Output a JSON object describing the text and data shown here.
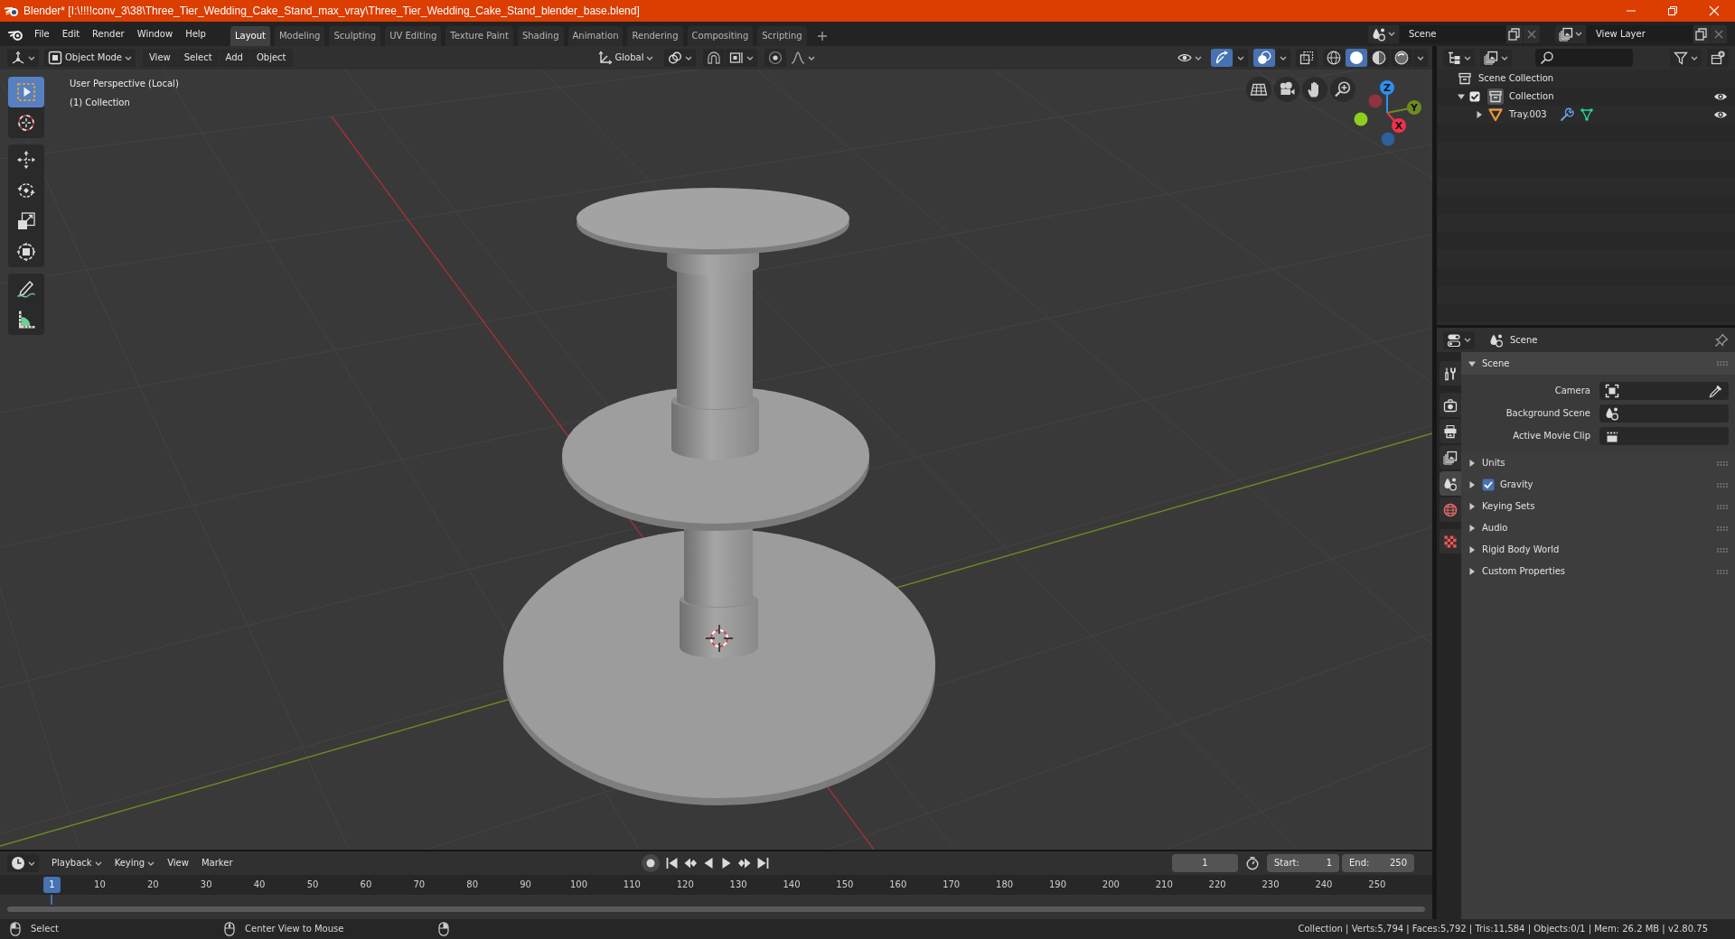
{
  "title_bar": {
    "title": "Blender* [I:\\!!!!conv_3\\38\\Three_Tier_Wedding_Cake_Stand_max_vray\\Three_Tier_Wedding_Cake_Stand_blender_base.blend]"
  },
  "top_bar": {
    "menus": [
      "File",
      "Edit",
      "Render",
      "Window",
      "Help"
    ],
    "workspaces": [
      {
        "label": "Layout",
        "selected": true
      },
      {
        "label": "Modeling",
        "selected": false
      },
      {
        "label": "Sculpting",
        "selected": false
      },
      {
        "label": "UV Editing",
        "selected": false
      },
      {
        "label": "Texture Paint",
        "selected": false
      },
      {
        "label": "Shading",
        "selected": false
      },
      {
        "label": "Animation",
        "selected": false
      },
      {
        "label": "Rendering",
        "selected": false
      },
      {
        "label": "Compositing",
        "selected": false
      },
      {
        "label": "Scripting",
        "selected": false
      }
    ],
    "scene": "Scene",
    "view_layer": "View Layer"
  },
  "viewport": {
    "mode": "Object Mode",
    "menus": [
      "View",
      "Select",
      "Add",
      "Object"
    ],
    "orientation": "Global",
    "toggles": [
      {
        "kind": "gizmos",
        "on": true
      },
      {
        "kind": "overlays",
        "on": true
      },
      {
        "kind": "xray",
        "on": false
      }
    ],
    "shading_modes": [
      {
        "kind": "wireframe",
        "selected": false
      },
      {
        "kind": "solid",
        "selected": true
      },
      {
        "kind": "material",
        "selected": false
      },
      {
        "kind": "rendered",
        "selected": false
      }
    ],
    "toolbar": [
      [
        {
          "kind": "select_box",
          "selected": true
        },
        {
          "kind": "cursor",
          "selected": false
        }
      ],
      [
        {
          "kind": "move",
          "selected": false
        },
        {
          "kind": "rotate",
          "selected": false
        },
        {
          "kind": "scale",
          "selected": false
        },
        {
          "kind": "transform",
          "selected": false
        }
      ],
      [
        {
          "kind": "annotate",
          "selected": false
        },
        {
          "kind": "measure",
          "selected": false
        }
      ]
    ],
    "info": [
      "User Perspective (Local)",
      "(1) Collection"
    ],
    "gizmo_axes": [
      "Z",
      "Y",
      "X"
    ]
  },
  "outliner": {
    "tree": [
      {
        "label": "Scene Collection",
        "kind": "scene_collection",
        "children": [
          {
            "label": "Collection",
            "kind": "collection",
            "expanded": true,
            "checked": true,
            "active": true,
            "visible": true,
            "children": [
              {
                "label": "Tray.003",
                "kind": "mesh",
                "expanded": false,
                "visible": true
              }
            ]
          }
        ]
      }
    ]
  },
  "properties": {
    "context": "Scene",
    "tabs": [
      [
        {
          "kind": "tool",
          "selected": false
        }
      ],
      [
        {
          "kind": "render",
          "selected": false
        },
        {
          "kind": "output",
          "selected": false
        },
        {
          "kind": "view_layer",
          "selected": false
        },
        {
          "kind": "scene",
          "selected": true
        },
        {
          "kind": "world",
          "selected": false
        }
      ],
      [
        {
          "kind": "texture",
          "selected": false
        }
      ]
    ],
    "panels": [
      {
        "title": "Scene",
        "expanded": true,
        "fields": [
          {
            "label": "Camera",
            "kind": "camera"
          },
          {
            "label": "Background Scene",
            "kind": "scene"
          },
          {
            "label": "Active Movie Clip",
            "kind": "clip"
          }
        ]
      },
      {
        "title": "Units",
        "expanded": false
      },
      {
        "title": "Gravity",
        "expanded": false,
        "checked": true
      },
      {
        "title": "Keying Sets",
        "expanded": false
      },
      {
        "title": "Audio",
        "expanded": false
      },
      {
        "title": "Rigid Body World",
        "expanded": false
      },
      {
        "title": "Custom Properties",
        "expanded": false
      }
    ]
  },
  "timeline": {
    "menus": [
      {
        "label": "Playback",
        "kind": "dropdown"
      },
      {
        "label": "Keying",
        "kind": "dropdown"
      },
      {
        "label": "View",
        "kind": "menu"
      },
      {
        "label": "Marker",
        "kind": "menu"
      }
    ],
    "current_frame": "1",
    "start_label": "Start:",
    "start": "1",
    "end_label": "End:",
    "end": "250",
    "playhead": "1",
    "ruler": [
      "10",
      "20",
      "30",
      "40",
      "50",
      "60",
      "70",
      "80",
      "90",
      "100",
      "110",
      "120",
      "130",
      "140",
      "150",
      "160",
      "170",
      "180",
      "190",
      "200",
      "210",
      "220",
      "230",
      "240",
      "250"
    ]
  },
  "status_bar": {
    "hints": [
      {
        "kind": "left_click",
        "label": "Select"
      },
      {
        "kind": "middle_click",
        "label": "Center View to Mouse"
      },
      {
        "kind": "right_click"
      }
    ],
    "stats": "Collection | Verts:5,794 | Faces:5,792 | Tris:11,584 | Objects:0/1 | Mem: 26.2 MB | v2.80.75"
  }
}
